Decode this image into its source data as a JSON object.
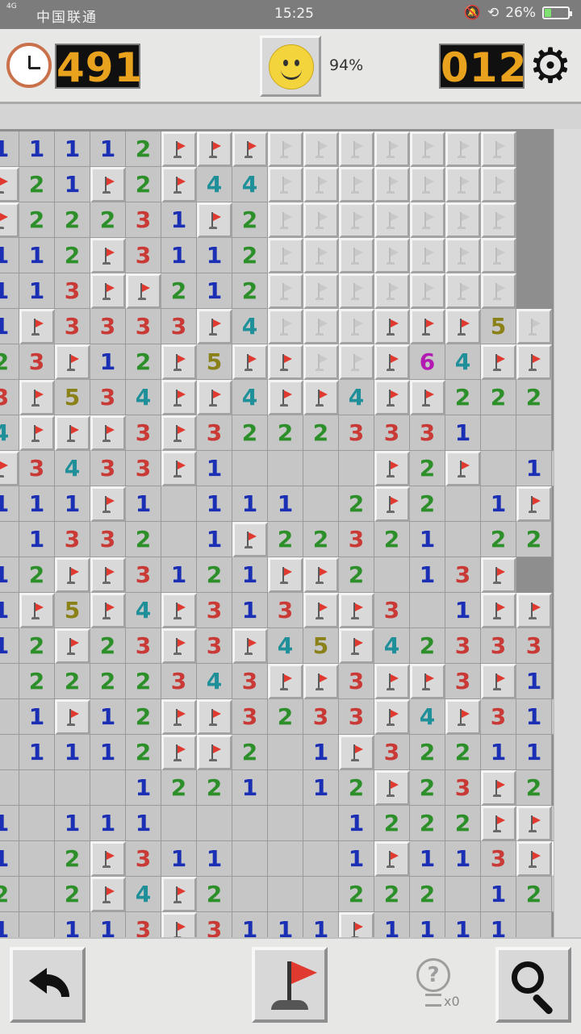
{
  "status_bar": {
    "network": "4G",
    "carrier": "中国联通",
    "time": "15:25",
    "battery": "26%"
  },
  "header": {
    "timer": "491",
    "mines_left": "012",
    "progress": "94%",
    "icons": {
      "clock": "clock-icon",
      "face": "smiley-face-icon",
      "settings": "gear-icon"
    }
  },
  "board": {
    "legend": "H = hidden, F = flag, . = opened empty, digit = number",
    "rows": [
      "11112FFFHHHHHHH",
      "F21F2F44HHHHHHH",
      "F22231F2HHHHHHH",
      "112F3112HHHHHHH",
      "113FF212HHHHHHH",
      "1F3333F4HHHFFF5H",
      "23F12F5FFHHF64FF",
      "3F534FF4FF4FF222",
      "4FFF3F32223331..",
      "F3433F1....F2F.11",
      "111F1.111.2F2.1F",
      ".1332.1F22321.22",
      "12FF3121FF2.13F",
      "1F5F4F313FF3.1FF",
      "12F23F3F45F42333",
      ".2222343FF3FF3F1",
      ".1F12FF3233F4F311",
      ".1112FF2.1F3221 1",
      "....1221.12F23F2",
      "1.111.....1222FF4",
      "1.2F311...1F113FF",
      "2.2F4F2...222.122",
      "1.113F3111F1111."
    ]
  },
  "toolbar": {
    "hint_count": "x0",
    "icons": {
      "undo": "undo-arrow-icon",
      "flag_mode": "flag-icon",
      "hint": "lightbulb-hint-icon",
      "zoom": "magnifier-icon"
    }
  },
  "colors": {
    "n1": "#1b2fb5",
    "n2": "#2d8f2a",
    "n3": "#c93a37",
    "n4": "#1f8f99",
    "n5": "#8a8219",
    "n6": "#b21ab3",
    "timer_digits": "#e8a21e",
    "flag": "#e03a30"
  }
}
